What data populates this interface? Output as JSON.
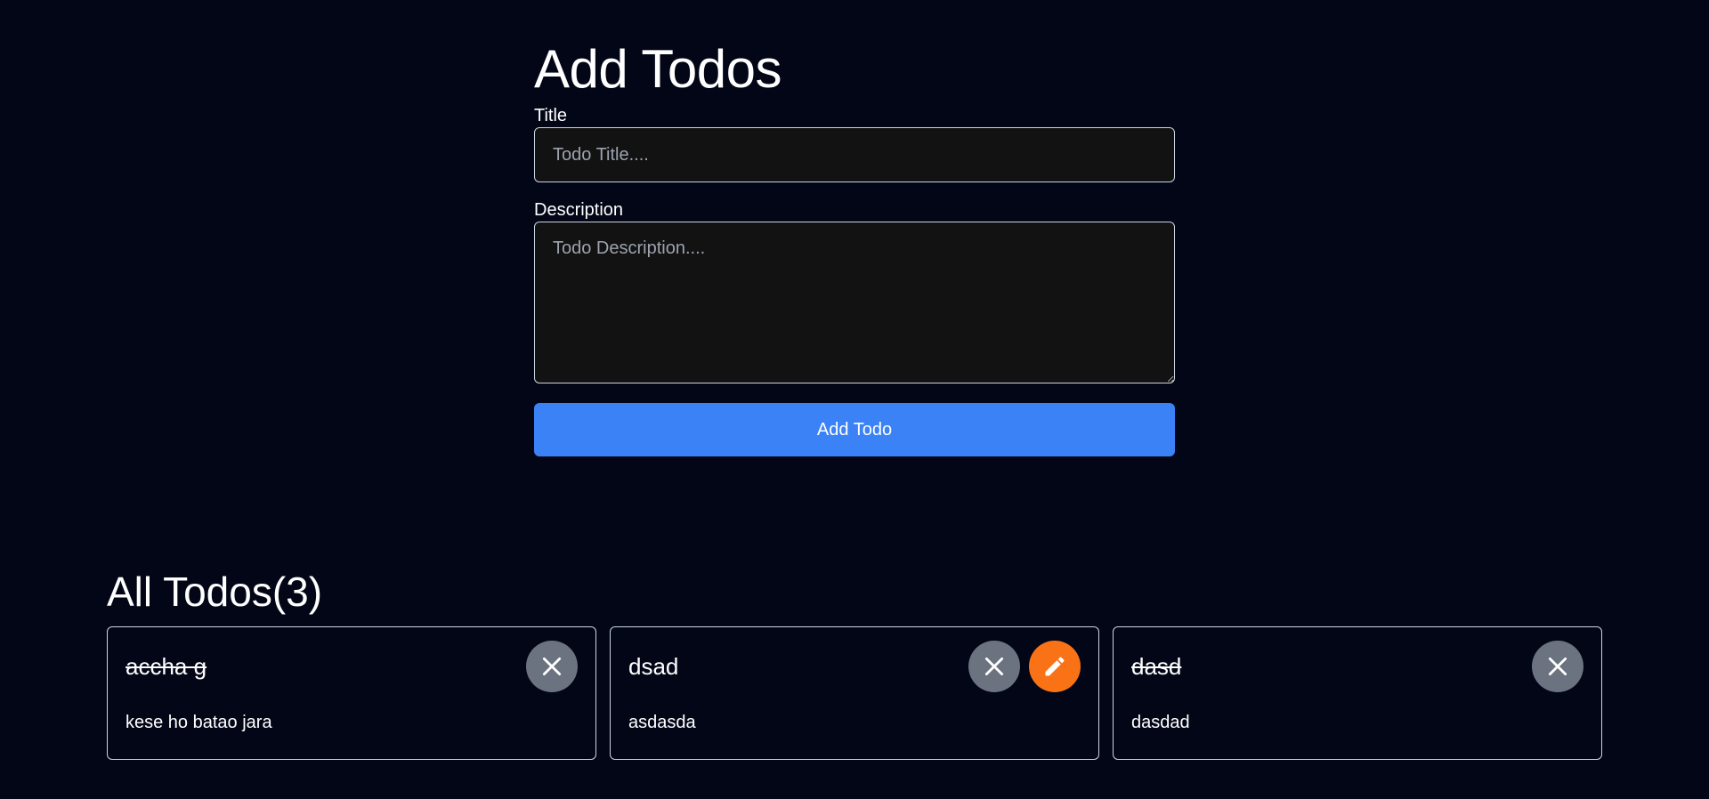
{
  "form": {
    "heading": "Add Todos",
    "title_label": "Title",
    "title_placeholder": "Todo Title....",
    "title_value": "",
    "description_label": "Description",
    "description_placeholder": "Todo Description....",
    "description_value": "",
    "submit_label": "Add Todo"
  },
  "todos": {
    "heading": "All Todos",
    "count_text": "(3)",
    "items": [
      {
        "title": "accha g",
        "description": "kese ho batao jara",
        "completed": true,
        "editable": false
      },
      {
        "title": "dsad",
        "description": "asdasda",
        "completed": false,
        "editable": true
      },
      {
        "title": "dasd",
        "description": "dasdad",
        "completed": true,
        "editable": false
      }
    ]
  },
  "icons": {
    "delete": "close-icon",
    "edit": "pencil-icon"
  },
  "colors": {
    "background": "#020617",
    "primary": "#3b82f6",
    "delete": "#6b7280",
    "edit": "#f97316"
  }
}
